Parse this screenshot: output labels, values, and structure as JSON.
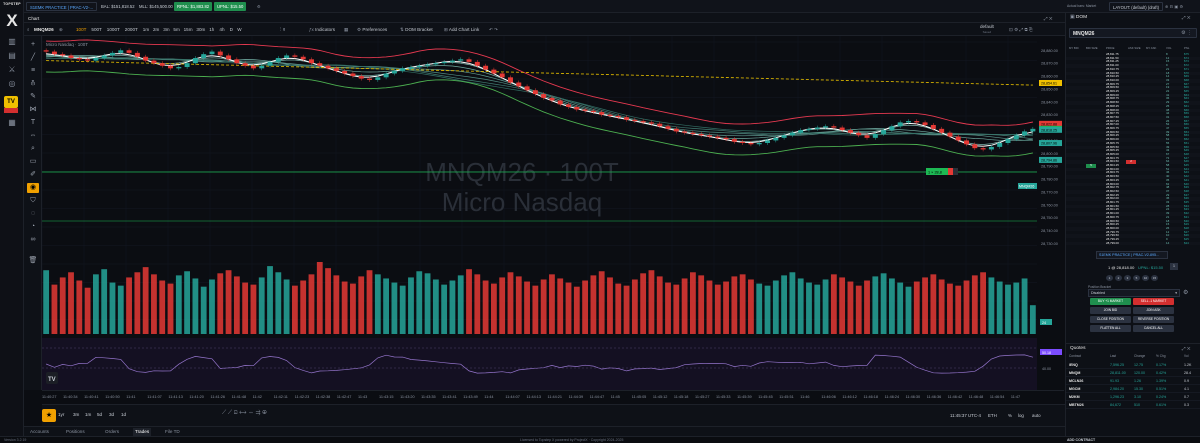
{
  "app": {
    "logo_letter": "X",
    "logo_sub": "TOPSTEP",
    "tv_badge": "TV"
  },
  "topbar": {
    "account": "S1EMK PRACTICE | PRAC-V2-...",
    "bal": "BAL: $151,818.52",
    "mll": "MLL: $145,500.00",
    "rpnl": "RPNL: $1,883.82",
    "upnl": "UPNL: $15.50",
    "actual_bars": "Actual bars: Market",
    "layout": "LAYOUT: (default) (draft)"
  },
  "chart_tab": {
    "label": "Chart"
  },
  "toolbar": {
    "symbol": "MNQM26",
    "intervals": [
      "100T",
      "500T",
      "1000T",
      "2000T",
      "1m",
      "2m",
      "3m",
      "5m",
      "15m",
      "30m",
      "1h",
      "4h",
      "D",
      "W"
    ],
    "active_interval": "100T",
    "indicators": "Indicators",
    "preferences": "Preferences",
    "dom_bracket": "DOM Bracket",
    "add_chart_link": "Add Chart Link",
    "default_label": "default",
    "default_sub": "Saved"
  },
  "chart": {
    "legend": "Micro Nasdaq · 100T",
    "watermark_1": "MNQM26 · 100T",
    "watermark_2": "Micro Nasdaq",
    "position_tag": "1 × 28,8",
    "symbol_tag": "MNQM26",
    "time_scale": [
      "11:40:27",
      "11:40:34",
      "11:40:41",
      "11:40:50",
      "11:41",
      "11:41:07",
      "11:41:13",
      "11:41:20",
      "11:41:26",
      "11:41:48",
      "11:42",
      "11:42:11",
      "11:42:23",
      "11:42:38",
      "11:42:47",
      "11:43",
      "11:43:15",
      "11:43:20",
      "11:43:35",
      "11:43:41",
      "11:43:49",
      "11:44",
      "11:44:07",
      "11:44:13",
      "11:44:21",
      "11:44:39",
      "11:44:47",
      "11:45",
      "11:45:05",
      "11:45:12",
      "11:45:18",
      "11:45:27",
      "11:45:33",
      "11:45:39",
      "11:45:45",
      "11:45:51",
      "11:46",
      "11:46:06",
      "11:46:12",
      "11:46:18",
      "11:46:24",
      "11:46:30",
      "11:46:36",
      "11:46:42",
      "11:46:48",
      "11:46:54",
      "11:47"
    ],
    "rsi_label": "50.18",
    "rsi_level": "40.00",
    "volume_label": "24"
  },
  "chart_data": {
    "type": "candlestick",
    "price_scale": [
      "28,880.00",
      "28,870.00",
      "28,860.00",
      "28,850.00",
      "28,840.00",
      "28,830.00",
      "28,820.00",
      "28,810.00",
      "28,800.00",
      "28,790.00",
      "28,780.00",
      "28,770.00",
      "28,760.00",
      "28,750.00",
      "28,740.00",
      "28,730.00"
    ],
    "price_tags": [
      {
        "value": "28,854.61",
        "color": "#f0c000"
      },
      {
        "value": "28,822.88",
        "color": "#e53935"
      },
      {
        "value": "28,819.00",
        "color": "#1db954"
      },
      {
        "value": "28,818.25",
        "color": "#26a69a"
      },
      {
        "value": "28,807.96",
        "color": "#26a69a"
      },
      {
        "value": "28,794.86",
        "color": "#26a69a"
      }
    ],
    "ylim": [
      28728,
      28888
    ],
    "series": [
      {
        "name": "close",
        "values": [
          28879,
          28877,
          28876,
          28874,
          28873,
          28872,
          28874,
          28876,
          28878,
          28880,
          28878,
          28875,
          28872,
          28870,
          28868,
          28866,
          28867,
          28870,
          28874,
          28877,
          28879,
          28876,
          28873,
          28870,
          28868,
          28866,
          28868,
          28871,
          28874,
          28876,
          28875,
          28873,
          28870,
          28868,
          28866,
          28864,
          28862,
          28860,
          28858,
          28857,
          28859,
          28862,
          28864,
          28866,
          28867,
          28868,
          28869,
          28870,
          28871,
          28872,
          28873,
          28871,
          28868,
          28865,
          28862,
          28859,
          28855,
          28852,
          28849,
          28846,
          28843,
          28841,
          28838,
          28836,
          28834,
          28833,
          28832,
          28830,
          28829,
          28828,
          28826,
          28825,
          28824,
          28823,
          28821,
          28819,
          28817,
          28816,
          28815,
          28814,
          28813,
          28812,
          28811,
          28809,
          28808,
          28807,
          28808,
          28810,
          28812,
          28814,
          28816,
          28818,
          28819,
          28820,
          28821,
          28820,
          28818,
          28816,
          28814,
          28812,
          28815,
          28818,
          28821,
          28824,
          28825,
          28824,
          28822,
          28819,
          28816,
          28813,
          28810,
          28807,
          28804,
          28803,
          28805,
          28808,
          28811,
          28814,
          28817,
          28819
        ]
      }
    ],
    "volume": [
      62,
      48,
      55,
      60,
      52,
      45,
      58,
      63,
      50,
      47,
      55,
      60,
      65,
      58,
      52,
      49,
      57,
      61,
      54,
      46,
      53,
      59,
      62,
      56,
      50,
      48,
      55,
      66,
      60,
      53,
      47,
      52,
      58,
      70,
      64,
      57,
      51,
      49,
      56,
      62,
      58,
      54,
      50,
      47,
      55,
      61,
      59,
      53,
      48,
      52,
      57,
      63,
      58,
      52,
      49,
      55,
      60,
      56,
      51,
      47,
      53,
      58,
      54,
      50,
      46,
      52,
      57,
      61,
      55,
      49,
      47,
      53,
      59,
      62,
      56,
      50,
      48,
      54,
      60,
      57,
      52,
      48,
      51,
      56,
      58,
      53,
      49,
      47,
      52,
      57,
      60,
      54,
      50,
      48,
      53,
      58,
      55,
      51,
      47,
      52,
      56,
      59,
      54,
      50,
      46,
      51,
      55,
      58,
      53,
      49,
      47,
      52,
      57,
      60,
      55,
      51,
      48,
      50,
      54,
      28
    ]
  },
  "range_bar": {
    "ranges": [
      "1yr",
      "3m",
      "1m",
      "5d",
      "3d",
      "1d"
    ],
    "clock": "11:45:37 UTC-4",
    "session": "ETH",
    "pct": "%",
    "log": "log",
    "auto": "auto"
  },
  "bottom_tabs": [
    "Accounts",
    "Positions",
    "Orders",
    "Trades",
    "File TD"
  ],
  "active_bottom_tab": "Trades",
  "status": {
    "left": "Version 3.2.19",
    "center": "Licensed to Topstep X powered by ProjectX · Copyright 2024-2025",
    "right": "ADD CONTRACT"
  },
  "dom": {
    "title": "DOM",
    "symbol": "MNQM26",
    "headers": [
      "MY BID",
      "BID SIZE",
      "PRICE",
      "ASK SIZE",
      "MY ASK",
      "VOL",
      "PNL"
    ],
    "rows": [
      {
        "price": "28,811.75",
        "vol": "8",
        "pnl": "$75"
      },
      {
        "price": "28,811.50",
        "vol": "12",
        "pnl": "$74"
      },
      {
        "price": "28,811.25",
        "vol": "15",
        "pnl": "$73"
      },
      {
        "price": "28,811.00",
        "vol": "9",
        "pnl": "$72"
      },
      {
        "price": "28,810.75",
        "vol": "21",
        "pnl": "$71"
      },
      {
        "price": "28,810.50",
        "vol": "18",
        "pnl": "$70"
      },
      {
        "price": "28,810.25",
        "vol": "14",
        "pnl": "$69"
      },
      {
        "price": "28,810.00",
        "vol": "33",
        "pnl": "$68"
      },
      {
        "price": "28,809.75",
        "vol": "27",
        "pnl": "$67"
      },
      {
        "price": "28,809.50",
        "vol": "19",
        "pnl": "$66"
      },
      {
        "price": "28,809.25",
        "vol": "22",
        "pnl": "$65"
      },
      {
        "price": "28,809.00",
        "vol": "41",
        "pnl": "$64"
      },
      {
        "price": "28,808.75",
        "vol": "36",
        "pnl": "$63"
      },
      {
        "price": "28,808.50",
        "vol": "29",
        "pnl": "$62"
      },
      {
        "price": "28,808.25",
        "vol": "25",
        "pnl": "$61"
      },
      {
        "price": "28,808.00",
        "vol": "38",
        "pnl": "$60"
      },
      {
        "price": "28,807.75",
        "vol": "44",
        "pnl": "$59"
      },
      {
        "price": "28,807.50",
        "vol": "31",
        "pnl": "$58"
      },
      {
        "price": "28,807.25",
        "vol": "26",
        "pnl": "$57"
      },
      {
        "price": "28,807.00",
        "vol": "52",
        "pnl": "$56"
      },
      {
        "price": "28,806.75",
        "vol": "47",
        "pnl": "$55"
      },
      {
        "price": "28,806.50",
        "vol": "39",
        "pnl": "$54"
      },
      {
        "price": "28,806.25",
        "vol": "58",
        "pnl": "$53"
      },
      {
        "price": "28,806.00",
        "vol": "61",
        "pnl": "$52"
      },
      {
        "price": "28,805.75",
        "vol": "55",
        "pnl": "$51"
      },
      {
        "price": "28,805.50",
        "vol": "49",
        "pnl": "$50"
      },
      {
        "price": "28,805.25",
        "vol": "43",
        "pnl": "$49"
      },
      {
        "price": "28,805.00",
        "vol": "67",
        "pnl": "$48"
      },
      {
        "price": "28,804.75",
        "vol": "72",
        "pnl": "$47"
      },
      {
        "price": "28,804.50",
        "vol": "64",
        "pnl": "$46",
        "bid": "",
        "ask": "2"
      },
      {
        "price": "28,804.25",
        "vol": "58",
        "pnl": "$45",
        "bid": "5",
        "ask": ""
      },
      {
        "price": "28,804.00",
        "vol": "51",
        "pnl": "$44"
      },
      {
        "price": "28,803.75",
        "vol": "46",
        "pnl": "$43"
      },
      {
        "price": "28,803.50",
        "vol": "40",
        "pnl": "$42"
      },
      {
        "price": "28,803.25",
        "vol": "35",
        "pnl": "$41"
      },
      {
        "price": "28,803.00",
        "vol": "62",
        "pnl": "$40"
      },
      {
        "price": "28,802.75",
        "vol": "48",
        "pnl": "$39"
      },
      {
        "price": "28,802.50",
        "vol": "37",
        "pnl": "$38"
      },
      {
        "price": "28,802.25",
        "vol": "29",
        "pnl": "$37"
      },
      {
        "price": "28,802.00",
        "vol": "45",
        "pnl": "$36"
      },
      {
        "price": "28,801.75",
        "vol": "33",
        "pnl": "$35"
      },
      {
        "price": "28,801.50",
        "vol": "28",
        "pnl": "$34"
      },
      {
        "price": "28,801.25",
        "vol": "24",
        "pnl": "$33"
      },
      {
        "price": "28,801.00",
        "vol": "39",
        "pnl": "$32"
      },
      {
        "price": "28,800.75",
        "vol": "21",
        "pnl": "$31"
      },
      {
        "price": "28,800.50",
        "vol": "18",
        "pnl": "$30"
      },
      {
        "price": "28,800.25",
        "vol": "15",
        "pnl": "$29"
      },
      {
        "price": "28,800.00",
        "vol": "26",
        "pnl": "$28"
      },
      {
        "price": "28,799.75",
        "vol": "12",
        "pnl": "$27"
      },
      {
        "price": "28,799.50",
        "vol": "10",
        "pnl": "$26"
      },
      {
        "price": "28,799.25",
        "vol": "9",
        "pnl": "$25"
      },
      {
        "price": "28,799.00",
        "vol": "14",
        "pnl": "$24"
      }
    ],
    "account": "S1EMK PRACTICE | PRAC-V2-895...",
    "position": "1 @ 28,818.00",
    "upnl": "UPNL: $15.50",
    "qty": "1",
    "qty_options": [
      "1",
      "2",
      "3",
      "5",
      "10",
      "15"
    ],
    "dropdown_label": "Position Bracket",
    "dropdown_value": "Disabled",
    "buy_mkt": "BUY +1 MARKET",
    "sell_mkt": "SELL -1 MARKET",
    "join_bid": "JOIN BID",
    "join_ask": "JOIN ASK",
    "close_pos": "CLOSE POSITION",
    "reverse_pos": "REVERSE POSITION",
    "flatten_all": "FLATTEN ALL",
    "cancel_all": "CANCEL ALL"
  },
  "quotes": {
    "title": "Quotes",
    "headers": [
      "Contract",
      "Last",
      "Change",
      "% Chg",
      "Vol"
    ],
    "rows": [
      {
        "sym": "/ENQ",
        "last": "7,596.25",
        "chg": "12.75",
        "pct": "0.17%",
        "vol": "1.2K",
        "up": true
      },
      {
        "sym": "MNQM",
        "last": "28,811.00",
        "chg": "120.00",
        "pct": "0.42%",
        "vol": "28.4",
        "up": true
      },
      {
        "sym": "MCLN26",
        "last": "91.93",
        "chg": "1.26",
        "pct": "1.39%",
        "vol": "0.9",
        "up": true
      },
      {
        "sym": "MGCM",
        "last": "2,984.20",
        "chg": "15.30",
        "pct": "0.51%",
        "vol": "4.1",
        "up": true
      },
      {
        "sym": "M2KM",
        "last": "1,296.23",
        "chg": "3.10",
        "pct": "0.24%",
        "vol": "0.7",
        "up": true
      },
      {
        "sym": "MBTM26",
        "last": "84,672",
        "chg": "510",
        "pct": "0.61%",
        "vol": "0.3",
        "up": true
      }
    ]
  },
  "colors": {
    "up": "#26a69a",
    "down": "#e53935",
    "accent": "#f0c000",
    "bg": "#0b0d12"
  }
}
